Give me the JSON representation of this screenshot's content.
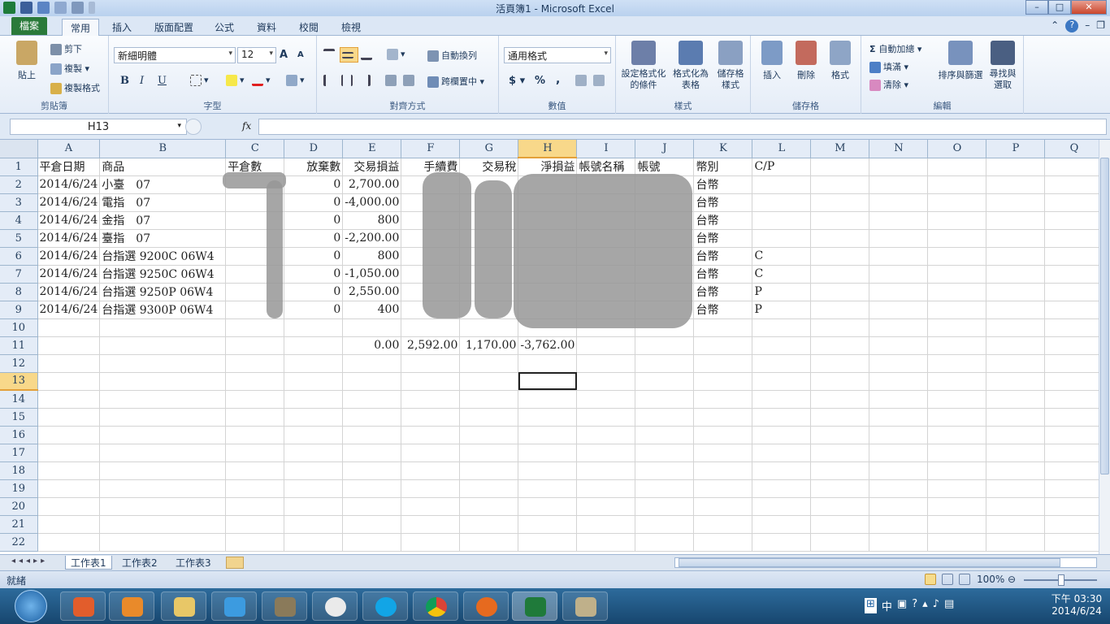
{
  "window": {
    "title": "活頁簿1 - Microsoft Excel",
    "min": "–",
    "max": "□",
    "close": "✕"
  },
  "tabs": [
    "檔案",
    "常用",
    "插入",
    "版面配置",
    "公式",
    "資料",
    "校閱",
    "檢視"
  ],
  "tab_help": "?",
  "ribbon": {
    "clipboard": {
      "paste": "貼上",
      "cut": "剪下",
      "copy": "複製",
      "format_painter": "複製格式",
      "name": "剪貼簿"
    },
    "font": {
      "family": "新細明體",
      "size": "12",
      "bold": "B",
      "italic": "I",
      "underline": "U",
      "name": "字型",
      "grow": "A",
      "shrink": "A"
    },
    "alignment": {
      "wrap": "自動換列",
      "merge": "跨欄置中",
      "name": "對齊方式"
    },
    "number": {
      "format": "通用格式",
      "currency": "$",
      "percent": "%",
      "comma": ",",
      "name": "數值"
    },
    "styles": {
      "conditional": "設定格式化的條件",
      "as_table": "格式化為表格",
      "cell_styles": "儲存格樣式",
      "name": "樣式"
    },
    "cells": {
      "insert": "插入",
      "delete": "刪除",
      "format": "格式",
      "name": "儲存格"
    },
    "editing": {
      "autosum": "自動加總",
      "fill": "填滿",
      "clear": "清除",
      "sort": "排序與篩選",
      "find": "尋找與選取",
      "name": "編輯"
    }
  },
  "formula_bar": {
    "name_box": "H13",
    "fx": "fx",
    "value": ""
  },
  "columns": [
    "A",
    "B",
    "C",
    "D",
    "E",
    "F",
    "G",
    "H",
    "I",
    "J",
    "K",
    "L",
    "M",
    "N",
    "O",
    "P",
    "Q"
  ],
  "rows": [
    [
      "平倉日期",
      "商品",
      "平倉數",
      "放棄數",
      "交易損益",
      "手續費",
      "交易稅",
      "淨損益",
      "帳號名稱",
      "帳號",
      "幣別",
      "C/P",
      "",
      "",
      "",
      "",
      ""
    ],
    [
      "2014/6/24",
      "小臺　07",
      "",
      "0",
      "2,700.00",
      "",
      "",
      "",
      "",
      "",
      "台幣",
      "",
      "",
      "",
      "",
      "",
      ""
    ],
    [
      "2014/6/24",
      "電指　07",
      "",
      "0",
      "-4,000.00",
      "",
      "",
      "",
      "",
      "",
      "台幣",
      "",
      "",
      "",
      "",
      "",
      ""
    ],
    [
      "2014/6/24",
      "金指　07",
      "",
      "0",
      "800",
      "",
      "",
      "",
      "",
      "",
      "台幣",
      "",
      "",
      "",
      "",
      "",
      ""
    ],
    [
      "2014/6/24",
      "臺指　07",
      "",
      "0",
      "-2,200.00",
      "",
      "",
      "",
      "",
      "",
      "台幣",
      "",
      "",
      "",
      "",
      "",
      ""
    ],
    [
      "2014/6/24",
      "台指選 9200C 06W4",
      "",
      "0",
      "800",
      "",
      "",
      "",
      "",
      "",
      "台幣",
      "C",
      "",
      "",
      "",
      "",
      ""
    ],
    [
      "2014/6/24",
      "台指選 9250C 06W4",
      "",
      "0",
      "-1,050.00",
      "",
      "",
      "",
      "",
      "",
      "台幣",
      "C",
      "",
      "",
      "",
      "",
      ""
    ],
    [
      "2014/6/24",
      "台指選 9250P 06W4",
      "",
      "0",
      "2,550.00",
      "",
      "",
      "",
      "",
      "",
      "台幣",
      "P",
      "",
      "",
      "",
      "",
      ""
    ],
    [
      "2014/6/24",
      "台指選 9300P 06W4",
      "",
      "0",
      "400",
      "",
      "",
      "",
      "",
      "",
      "台幣",
      "P",
      "",
      "",
      "",
      "",
      ""
    ],
    [
      "",
      "",
      "",
      "",
      "",
      "",
      "",
      "",
      "",
      "",
      "",
      "",
      "",
      "",
      "",
      "",
      ""
    ],
    [
      "",
      "",
      "",
      "",
      "0.00",
      "2,592.00",
      "1,170.00",
      "-3,762.00",
      "",
      "",
      "",
      "",
      "",
      "",
      "",
      "",
      ""
    ],
    [
      "",
      "",
      "",
      "",
      "",
      "",
      "",
      "",
      "",
      "",
      "",
      "",
      "",
      "",
      "",
      "",
      ""
    ],
    [
      "",
      "",
      "",
      "",
      "",
      "",
      "",
      "",
      "",
      "",
      "",
      "",
      "",
      "",
      "",
      "",
      ""
    ],
    [
      "",
      "",
      "",
      "",
      "",
      "",
      "",
      "",
      "",
      "",
      "",
      "",
      "",
      "",
      "",
      "",
      ""
    ],
    [
      "",
      "",
      "",
      "",
      "",
      "",
      "",
      "",
      "",
      "",
      "",
      "",
      "",
      "",
      "",
      "",
      ""
    ],
    [
      "",
      "",
      "",
      "",
      "",
      "",
      "",
      "",
      "",
      "",
      "",
      "",
      "",
      "",
      "",
      "",
      ""
    ],
    [
      "",
      "",
      "",
      "",
      "",
      "",
      "",
      "",
      "",
      "",
      "",
      "",
      "",
      "",
      "",
      "",
      ""
    ],
    [
      "",
      "",
      "",
      "",
      "",
      "",
      "",
      "",
      "",
      "",
      "",
      "",
      "",
      "",
      "",
      "",
      ""
    ],
    [
      "",
      "",
      "",
      "",
      "",
      "",
      "",
      "",
      "",
      "",
      "",
      "",
      "",
      "",
      "",
      "",
      ""
    ],
    [
      "",
      "",
      "",
      "",
      "",
      "",
      "",
      "",
      "",
      "",
      "",
      "",
      "",
      "",
      "",
      "",
      ""
    ],
    [
      "",
      "",
      "",
      "",
      "",
      "",
      "",
      "",
      "",
      "",
      "",
      "",
      "",
      "",
      "",
      "",
      ""
    ],
    [
      "",
      "",
      "",
      "",
      "",
      "",
      "",
      "",
      "",
      "",
      "",
      "",
      "",
      "",
      "",
      "",
      ""
    ]
  ],
  "sheet_tabs": [
    "工作表1",
    "工作表2",
    "工作表3"
  ],
  "status": {
    "ready": "就緒",
    "zoom": "100%"
  },
  "tray": {
    "time": "下午 03:30",
    "date": "2014/6/24",
    "ime": "中"
  }
}
